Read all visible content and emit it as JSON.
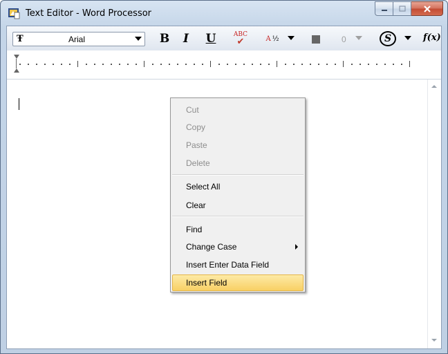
{
  "window": {
    "title": "Text Editor - Word Processor"
  },
  "toolbar": {
    "font_name": "Arial",
    "bold_label": "B",
    "italic_label": "I",
    "underline_label": "U",
    "spell_check_label": "ABC",
    "font_size_prefix": "A",
    "font_size_fraction": "½",
    "indent_value": "0",
    "currency_label": "S",
    "formula_label": "f(x)",
    "color_swatch": "#666666"
  },
  "context_menu": {
    "items": [
      {
        "label": "Cut",
        "enabled": false
      },
      {
        "label": "Copy",
        "enabled": false
      },
      {
        "label": "Paste",
        "enabled": false
      },
      {
        "label": "Delete",
        "enabled": false
      },
      {
        "label": "Select All",
        "enabled": true
      },
      {
        "label": "Clear",
        "enabled": true
      },
      {
        "label": "Find",
        "enabled": true
      },
      {
        "label": "Change Case",
        "enabled": true,
        "submenu": true
      },
      {
        "label": "Insert Enter Data Field",
        "enabled": true
      },
      {
        "label": "Insert Field",
        "enabled": true,
        "highlighted": true
      }
    ]
  },
  "colors": {
    "highlight": "#f8d064",
    "close_button": "#c24b33",
    "window_frame": "#c4d5e8"
  }
}
